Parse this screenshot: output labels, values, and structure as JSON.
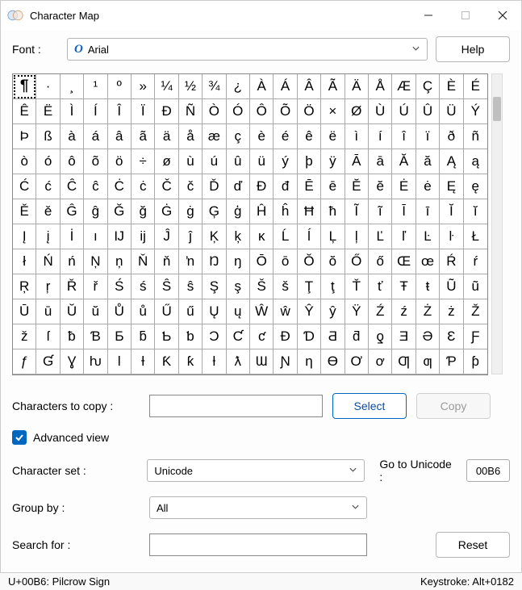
{
  "window": {
    "title": "Character Map"
  },
  "labels": {
    "font": "Font :",
    "chars_to_copy": "Characters to copy :",
    "advanced_view": "Advanced view",
    "character_set": "Character set :",
    "go_to_unicode": "Go to Unicode :",
    "group_by": "Group by :",
    "search_for": "Search for :"
  },
  "buttons": {
    "help": "Help",
    "select": "Select",
    "copy": "Copy",
    "reset": "Reset"
  },
  "font_select": {
    "value": "Arial"
  },
  "copy_field": {
    "value": ""
  },
  "character_set_select": {
    "value": "Unicode"
  },
  "group_by_select": {
    "value": "All"
  },
  "goto_field": {
    "value": "00B6"
  },
  "search_field": {
    "value": ""
  },
  "advanced_checked": true,
  "status": {
    "left": "U+00B6: Pilcrow Sign",
    "right": "Keystroke: Alt+0182"
  },
  "grid": {
    "selected_index": 0,
    "rows": [
      [
        "¶",
        "·",
        "¸",
        "¹",
        "º",
        "»",
        "¼",
        "½",
        "¾",
        "¿",
        "À",
        "Á",
        "Â",
        "Ã",
        "Ä",
        "Å",
        "Æ",
        "Ç",
        "È",
        "É"
      ],
      [
        "Ê",
        "Ë",
        "Ì",
        "Í",
        "Î",
        "Ï",
        "Ð",
        "Ñ",
        "Ò",
        "Ó",
        "Ô",
        "Õ",
        "Ö",
        "×",
        "Ø",
        "Ù",
        "Ú",
        "Û",
        "Ü",
        "Ý"
      ],
      [
        "Þ",
        "ß",
        "à",
        "á",
        "â",
        "ã",
        "ä",
        "å",
        "æ",
        "ç",
        "è",
        "é",
        "ê",
        "ë",
        "ì",
        "í",
        "î",
        "ï",
        "ð",
        "ñ"
      ],
      [
        "ò",
        "ó",
        "ô",
        "õ",
        "ö",
        "÷",
        "ø",
        "ù",
        "ú",
        "û",
        "ü",
        "ý",
        "þ",
        "ÿ",
        "Ā",
        "ā",
        "Ă",
        "ă",
        "Ą",
        "ą"
      ],
      [
        "Ć",
        "ć",
        "Ĉ",
        "ĉ",
        "Ċ",
        "ċ",
        "Č",
        "č",
        "Ď",
        "ď",
        "Đ",
        "đ",
        "Ē",
        "ē",
        "Ĕ",
        "ĕ",
        "Ė",
        "ė",
        "Ę",
        "ę"
      ],
      [
        "Ě",
        "ě",
        "Ĝ",
        "ĝ",
        "Ğ",
        "ğ",
        "Ġ",
        "ġ",
        "Ģ",
        "ģ",
        "Ĥ",
        "ĥ",
        "Ħ",
        "ħ",
        "Ĩ",
        "ĩ",
        "Ī",
        "ī",
        "Ĭ",
        "ĭ"
      ],
      [
        "Į",
        "į",
        "İ",
        "ı",
        "Ĳ",
        "ĳ",
        "Ĵ",
        "ĵ",
        "Ķ",
        "ķ",
        "ĸ",
        "Ĺ",
        "ĺ",
        "Ļ",
        "ļ",
        "Ľ",
        "ľ",
        "Ŀ",
        "ŀ",
        "Ł"
      ],
      [
        "ł",
        "Ń",
        "ń",
        "Ņ",
        "ņ",
        "Ň",
        "ň",
        "ŉ",
        "Ŋ",
        "ŋ",
        "Ō",
        "ō",
        "Ŏ",
        "ŏ",
        "Ő",
        "ő",
        "Œ",
        "œ",
        "Ŕ",
        "ŕ"
      ],
      [
        "Ŗ",
        "ŗ",
        "Ř",
        "ř",
        "Ś",
        "ś",
        "Ŝ",
        "ŝ",
        "Ş",
        "ş",
        "Š",
        "š",
        "Ţ",
        "ţ",
        "Ť",
        "ť",
        "Ŧ",
        "ŧ",
        "Ũ",
        "ũ"
      ],
      [
        "Ū",
        "ū",
        "Ŭ",
        "ŭ",
        "Ů",
        "ů",
        "Ű",
        "ű",
        "Ų",
        "ų",
        "Ŵ",
        "ŵ",
        "Ŷ",
        "ŷ",
        "Ÿ",
        "Ź",
        "ź",
        "Ż",
        "ż",
        "Ž"
      ],
      [
        "ž",
        "ſ",
        "ƀ",
        "Ɓ",
        "Ƃ",
        "ƃ",
        "Ƅ",
        "ƅ",
        "Ɔ",
        "Ƈ",
        "ƈ",
        "Ɖ",
        "Ɗ",
        "Ƌ",
        "ƌ",
        "ƍ",
        "Ǝ",
        "Ə",
        "Ɛ",
        "Ƒ"
      ],
      [
        "ƒ",
        "Ɠ",
        "Ɣ",
        "ƕ",
        "Ɩ",
        "Ɨ",
        "Ƙ",
        "ƙ",
        "ƚ",
        "ƛ",
        "Ɯ",
        "Ɲ",
        "ƞ",
        "Ɵ",
        "Ơ",
        "ơ",
        "Ƣ",
        "ƣ",
        "Ƥ",
        "ƥ"
      ]
    ]
  }
}
